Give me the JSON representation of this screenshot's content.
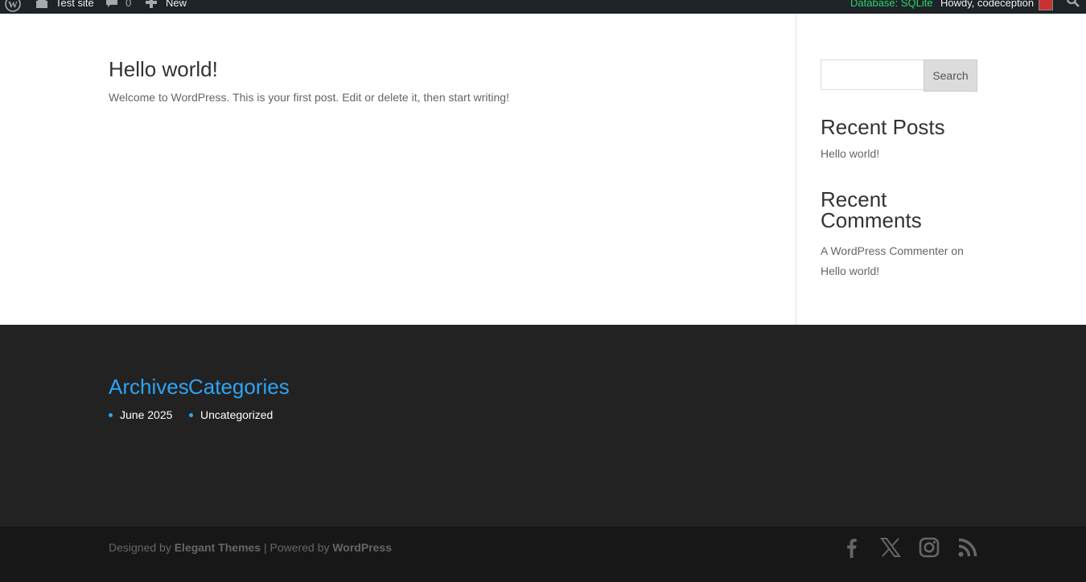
{
  "admin_bar": {
    "site_name": "Test site",
    "comments_count": "0",
    "new_label": "New",
    "database_label": "Database: SQLite",
    "howdy_label": "Howdy, codeception",
    "icons": [
      "wordpress-logo-icon",
      "home-icon",
      "comment-icon",
      "plus-icon",
      "avatar",
      "search-icon"
    ]
  },
  "post": {
    "title": "Hello world!",
    "excerpt": "Welcome to WordPress. This is your first post. Edit or delete it, then start writing!"
  },
  "sidebar": {
    "search": {
      "value": "",
      "placeholder": "",
      "button_label": "Search"
    },
    "recent_posts": {
      "title": "Recent Posts",
      "items": [
        "Hello world!"
      ]
    },
    "recent_comments": {
      "title_line1": "Recent",
      "title_line2": "Comments",
      "author": "A WordPress Commenter",
      "on": "on",
      "post": "Hello world!"
    }
  },
  "footer": {
    "archives": {
      "title": "Archives",
      "items": [
        "June 2025"
      ]
    },
    "categories": {
      "title": "Categories",
      "items": [
        "Uncategorized"
      ]
    },
    "credits": {
      "designed_by": "Designed by",
      "theme": "Elegant Themes",
      "powered_by": "| Powered by",
      "platform": "WordPress"
    },
    "social_icons": [
      "facebook-icon",
      "x-twitter-icon",
      "instagram-icon",
      "rss-icon"
    ]
  },
  "colors": {
    "accent": "#2ea3f2",
    "admin_bar_bg": "#1d2327",
    "footer_bg": "#222222",
    "bottom_bar_bg": "#171717",
    "db_green": "#2ed56f"
  }
}
